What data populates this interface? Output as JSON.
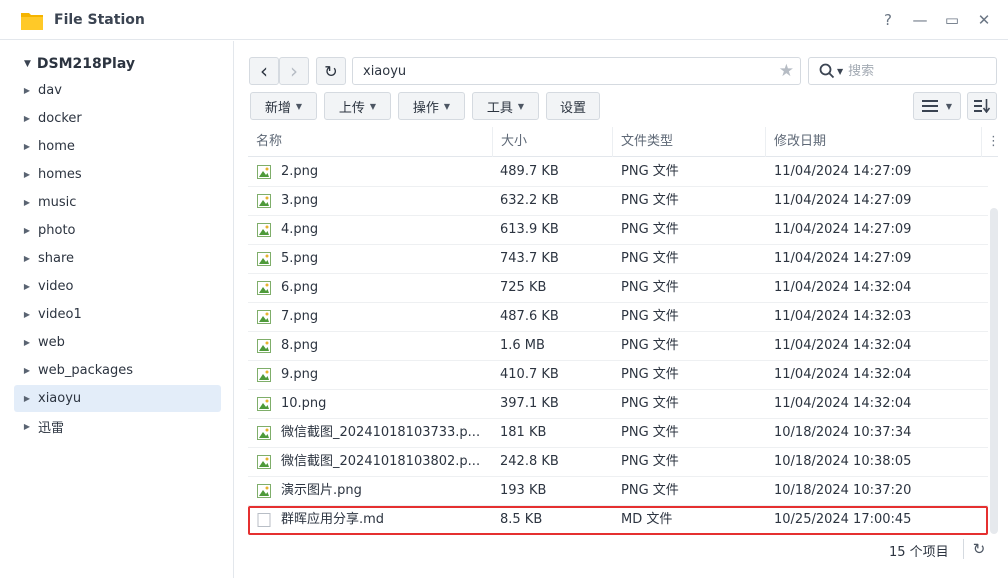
{
  "window": {
    "title": "File Station",
    "help": "?",
    "minimize": "—",
    "maximize": "▭",
    "close": "✕"
  },
  "sidebar": {
    "root": "DSM218Play",
    "items": [
      {
        "label": "dav"
      },
      {
        "label": "docker"
      },
      {
        "label": "home"
      },
      {
        "label": "homes"
      },
      {
        "label": "music"
      },
      {
        "label": "photo"
      },
      {
        "label": "share"
      },
      {
        "label": "video"
      },
      {
        "label": "video1"
      },
      {
        "label": "web"
      },
      {
        "label": "web_packages"
      },
      {
        "label": "xiaoyu",
        "selected": true
      },
      {
        "label": "迅雷"
      }
    ]
  },
  "toolbar": {
    "back": "‹",
    "forward": "›",
    "refresh": "↻",
    "path": "xiaoyu",
    "search_placeholder": "搜索",
    "buttons": {
      "create": "新增",
      "upload": "上传",
      "action": "操作",
      "tools": "工具",
      "settings": "设置"
    }
  },
  "table": {
    "columns": [
      "名称",
      "大小",
      "文件类型",
      "修改日期"
    ],
    "rows": [
      {
        "name": "2.png",
        "size": "489.7 KB",
        "type": "PNG 文件",
        "date": "11/04/2024 14:27:09",
        "icon": "image"
      },
      {
        "name": "3.png",
        "size": "632.2 KB",
        "type": "PNG 文件",
        "date": "11/04/2024 14:27:09",
        "icon": "image"
      },
      {
        "name": "4.png",
        "size": "613.9 KB",
        "type": "PNG 文件",
        "date": "11/04/2024 14:27:09",
        "icon": "image"
      },
      {
        "name": "5.png",
        "size": "743.7 KB",
        "type": "PNG 文件",
        "date": "11/04/2024 14:27:09",
        "icon": "image"
      },
      {
        "name": "6.png",
        "size": "725 KB",
        "type": "PNG 文件",
        "date": "11/04/2024 14:32:04",
        "icon": "image"
      },
      {
        "name": "7.png",
        "size": "487.6 KB",
        "type": "PNG 文件",
        "date": "11/04/2024 14:32:03",
        "icon": "image"
      },
      {
        "name": "8.png",
        "size": "1.6 MB",
        "type": "PNG 文件",
        "date": "11/04/2024 14:32:04",
        "icon": "image"
      },
      {
        "name": "9.png",
        "size": "410.7 KB",
        "type": "PNG 文件",
        "date": "11/04/2024 14:32:04",
        "icon": "image"
      },
      {
        "name": "10.png",
        "size": "397.1 KB",
        "type": "PNG 文件",
        "date": "11/04/2024 14:32:04",
        "icon": "image"
      },
      {
        "name": "微信截图_20241018103733.p...",
        "size": "181 KB",
        "type": "PNG 文件",
        "date": "10/18/2024 10:37:34",
        "icon": "image"
      },
      {
        "name": "微信截图_20241018103802.p...",
        "size": "242.8 KB",
        "type": "PNG 文件",
        "date": "10/18/2024 10:38:05",
        "icon": "image"
      },
      {
        "name": "演示图片.png",
        "size": "193 KB",
        "type": "PNG 文件",
        "date": "10/18/2024 10:37:20",
        "icon": "image"
      },
      {
        "name": "群晖应用分享.md",
        "size": "8.5 KB",
        "type": "MD 文件",
        "date": "10/25/2024 17:00:45",
        "icon": "document",
        "highlighted": true
      }
    ]
  },
  "status": {
    "count": "15 个项目"
  },
  "colors": {
    "highlight": "#e53030",
    "selected": "#e3edf9",
    "folder": "#f5b400"
  }
}
